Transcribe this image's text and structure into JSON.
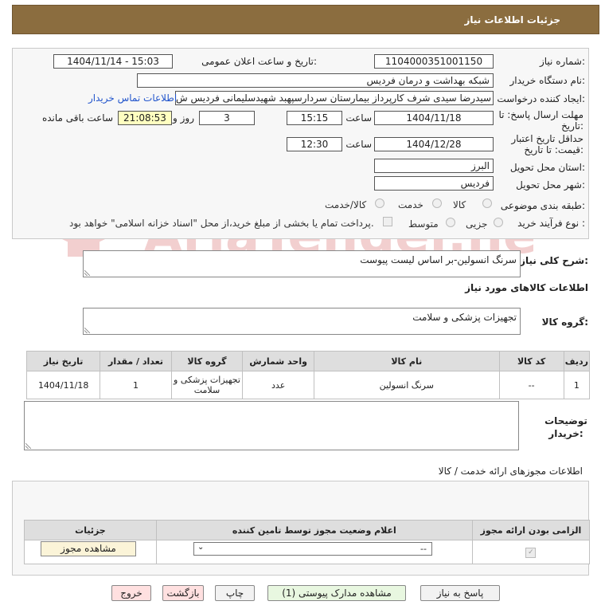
{
  "header": {
    "title": "جزئیات اطلاعات نیاز"
  },
  "form": {
    "need_number_label": "شماره نیاز:",
    "need_number": "1104000351001150",
    "announce_label": "تاریخ و ساعت اعلان عمومی:",
    "announce_value": "1404/11/14 - 15:03",
    "buyer_org_label": "نام دستگاه خریدار:",
    "buyer_org": "شبکه بهداشت و درمان فردیس",
    "requester_label": "ایجاد کننده درخواست:",
    "requester": "سیدرضا سیدی شرف کارپرداز بیمارستان سردارسپهبد شهیدسلیمانی فردیس ش",
    "contact_link": "اطلاعات تماس خریدار",
    "deadline_label_1": "مهلت ارسال پاسخ: تا",
    "deadline_label_2": "تاریخ:",
    "deadline_date": "1404/11/18",
    "time_word": "ساعت",
    "deadline_time": "15:15",
    "days_value": "3",
    "days_and": "روز و",
    "remaining_time": "21:08:53",
    "remaining_label": "ساعت باقی مانده",
    "validity_label_1": "حداقل تاریخ اعتبار",
    "validity_label_2": "قیمت: تا تاریخ:",
    "validity_date": "1404/12/28",
    "validity_time": "12:30",
    "province_label": "استان محل تحویل:",
    "province": "البرز",
    "city_label": "شهر محل تحویل:",
    "city": "فردیس",
    "category_label": "طبقه بندی موضوعی:",
    "category_options": [
      "کالا",
      "خدمت",
      "کالا/خدمت"
    ],
    "process_label": "نوع فرآیند خرید :",
    "process_options": [
      "جزیی",
      "متوسط"
    ],
    "payment_note": "پرداخت تمام یا بخشی از مبلغ خرید،از محل \"اسناد خزانه اسلامی\" خواهد بود.",
    "description_label": "شرح کلی نیاز:",
    "description": "سرنگ انسولین-بر اساس لیست پیوست",
    "goods_info_title": "اطلاعات کالاهای مورد نیاز",
    "goods_group_label": "گروه کالا:",
    "goods_group": "تجهیزات پزشکی و سلامت"
  },
  "goods_table": {
    "headers": [
      "ردیف",
      "کد کالا",
      "نام کالا",
      "واحد شمارش",
      "گروه کالا",
      "تعداد / مقدار",
      "تاریخ نیاز"
    ],
    "rows": [
      [
        "1",
        "--",
        "سرنگ انسولین",
        "عدد",
        "تجهیزات پزشکی و سلامت",
        "1",
        "1404/11/18"
      ]
    ]
  },
  "buyer_notes_label": "توضیحات خریدار:",
  "permits": {
    "title": "اطلاعات مجوزهای ارائه خدمت / کالا",
    "headers": [
      "الزامی بودن ارائه مجوز",
      "اعلام وضعیت مجوز توسط تامین کننده",
      "جزئیات"
    ],
    "select_value": "--",
    "view_button": "مشاهده مجوز"
  },
  "buttons": {
    "reply": "پاسخ به نیاز",
    "attachments": "مشاهده مدارک پیوستی (1)",
    "print": "چاپ",
    "back": "بازگشت",
    "exit": "خروج"
  },
  "watermark": "AriaTender.neT",
  "colors": {
    "header_bg": "#8b6d3f",
    "link": "#2255cc",
    "remaining_bg": "#ffffc0"
  }
}
